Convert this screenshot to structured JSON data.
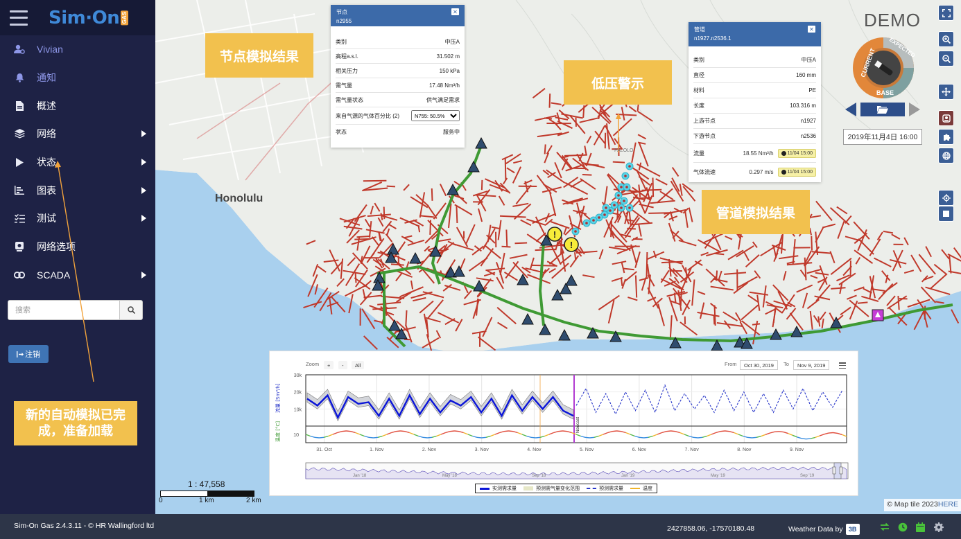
{
  "app": {
    "logo_text": "Sim·On",
    "logo_badge": "GAS",
    "version_text": "Sim-On Gas 2.4.3.11 - © HR Wallingford ltd"
  },
  "sidebar": {
    "items": [
      {
        "label": "Vivian",
        "icon": "user-gear-icon",
        "caret": false,
        "active": true
      },
      {
        "label": "通知",
        "icon": "bell-icon",
        "caret": false,
        "active": true
      },
      {
        "label": "概述",
        "icon": "document-icon",
        "caret": false,
        "active": false
      },
      {
        "label": "网络",
        "icon": "layers-icon",
        "caret": true,
        "active": false
      },
      {
        "label": "状态",
        "icon": "play-icon",
        "caret": true,
        "active": false
      },
      {
        "label": "图表",
        "icon": "bar-chart-icon",
        "caret": true,
        "active": false
      },
      {
        "label": "测试",
        "icon": "checklist-icon",
        "caret": true,
        "active": false
      },
      {
        "label": "网络选项",
        "icon": "network-options-icon",
        "caret": false,
        "active": false
      },
      {
        "label": "SCADA",
        "icon": "link-icon",
        "caret": true,
        "active": false
      }
    ],
    "search_placeholder": "搜索",
    "logout_label": "注销"
  },
  "callouts": {
    "node_result": "节点模拟结果",
    "low_pressure": "低压警示",
    "pipe_result": "管道模拟结果",
    "auto_sim": "新的自动模拟已完成，准备加载"
  },
  "map_labels": [
    "Honolulu",
    "PALOLO"
  ],
  "node_popup": {
    "title": "节点",
    "id": "n2955",
    "rows": [
      {
        "k": "类别",
        "v": "中压A"
      },
      {
        "k": "高程a.s.l.",
        "v": "31.502 m"
      },
      {
        "k": "相关压力",
        "v": "150 kPa"
      },
      {
        "k": "需气量",
        "v": "17.48 Nm³/h"
      },
      {
        "k": "需气量状态",
        "v": "供气满足需求"
      },
      {
        "k": "来自气源的气体百分比 (2)",
        "v": "N755:  50.5%"
      },
      {
        "k": "状态",
        "v": "服务中"
      }
    ]
  },
  "pipe_popup": {
    "title": "管道",
    "id": "n1927.n2536.1",
    "rows": [
      {
        "k": "类别",
        "v": "中压A",
        "mid": "",
        "badge": ""
      },
      {
        "k": "直径",
        "v": "160 mm",
        "mid": "",
        "badge": ""
      },
      {
        "k": "材料",
        "v": "PE",
        "mid": "",
        "badge": ""
      },
      {
        "k": "长度",
        "v": "103.316 m",
        "mid": "",
        "badge": ""
      },
      {
        "k": "上游节点",
        "v": "n1927",
        "mid": "",
        "badge": ""
      },
      {
        "k": "下游节点",
        "v": "n2536",
        "mid": "",
        "badge": ""
      },
      {
        "k": "流量",
        "v": "",
        "mid": "18.55 Nm³/h",
        "badge": "11/04 15:00"
      },
      {
        "k": "气体流速",
        "v": "",
        "mid": "0.297 m/s",
        "badge": "11/04 15:00"
      }
    ]
  },
  "demo_label": "DEMO",
  "dial": {
    "current": "CURRENT",
    "expected": "EXPECTED",
    "base": "BASE"
  },
  "datetime": "2019年11月4日 16:00",
  "chart_panel": {
    "zoom_label": "Zoom",
    "zoom_buttons": [
      "+",
      "-",
      "All"
    ],
    "from_label": "From",
    "from_value": "Oct 30, 2019",
    "to_label": "To",
    "to_value": "Nov 9, 2019",
    "nav_labels": [
      "Jan '18",
      "May '18",
      "Sep '18",
      "Jan '19",
      "May '19",
      "Sep '19"
    ],
    "vertical_line_label": "Nowcast",
    "legend": [
      "实测需求量",
      "预测需气量变化范围",
      "预测需求量",
      "温度"
    ]
  },
  "chart_data": {
    "type": "line",
    "x": [
      "31. Oct",
      "1. Nov",
      "2. Nov",
      "3. Nov",
      "4. Nov",
      "5. Nov",
      "6. Nov",
      "7. Nov",
      "8. Nov",
      "9. Nov"
    ],
    "ylabel": "流量 [Sm³/h]",
    "ylabel2": "温度 [°C]",
    "yticks": [
      "30k",
      "20k",
      "10k"
    ],
    "yticks2": [
      "10"
    ],
    "ylim": [
      0,
      30000
    ],
    "colors": {
      "measured": "#0a14d8",
      "range": "#9aa0a8",
      "forecast": "#2836c9",
      "temperature": "#f0b429"
    },
    "series": [
      {
        "name": "实测需求量",
        "values": [
          16000,
          12000,
          18000,
          5000,
          17000,
          13000,
          14000,
          6000,
          16000,
          6000,
          18000,
          7000,
          16000,
          8000,
          15000,
          12000,
          17000,
          8000,
          16000,
          6000,
          18000,
          9000,
          17000,
          10000,
          17000,
          9000,
          6000
        ]
      },
      {
        "name": "预测需求量",
        "values": [
          12000,
          22000,
          8000,
          19000,
          7000,
          20000,
          9000,
          21000,
          8000,
          24000,
          9000,
          19000,
          10000,
          18000,
          8000,
          21000,
          9000,
          20000,
          8000,
          19000,
          8000,
          21000,
          10000,
          22000,
          9000,
          20000,
          11000,
          21000
        ]
      }
    ]
  },
  "map_scale": {
    "ratio": "1 : 47,558",
    "ticks": [
      "0",
      "1 km",
      "2 km"
    ]
  },
  "attribution": {
    "text": "© Map tile 2023",
    "link": "HERE"
  },
  "footer": {
    "coords": "2427858.06, -17570180.48",
    "weather_label": "Weather Data by",
    "weather_logo": "3B"
  }
}
